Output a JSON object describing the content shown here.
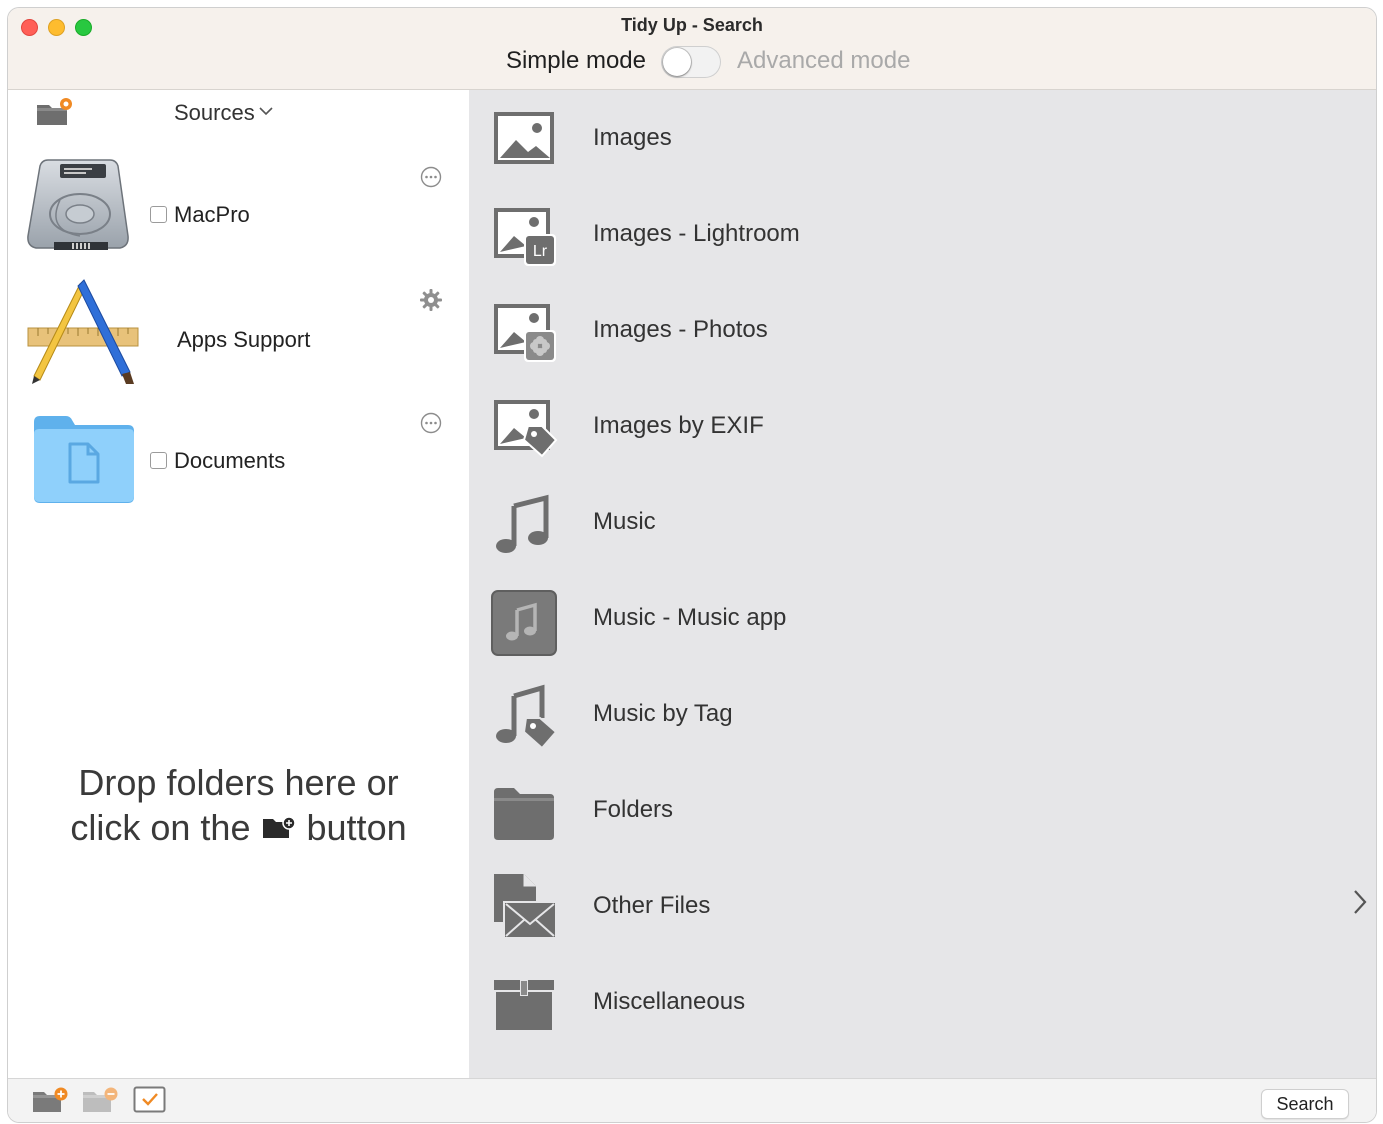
{
  "window": {
    "title": "Tidy Up - Search",
    "mode_simple": "Simple mode",
    "mode_advanced": "Advanced mode",
    "mode_toggle_on": false
  },
  "sidebar": {
    "header": "Sources",
    "items": [
      {
        "label": "MacPro",
        "icon": "hard-drive-icon",
        "action_icon": "ellipsis-circle-icon",
        "checked": false
      },
      {
        "label": "Apps Support",
        "icon": "app-store-tools-icon",
        "action_icon": "gear-icon"
      },
      {
        "label": "Documents",
        "icon": "documents-folder-icon",
        "action_icon": "ellipsis-circle-icon",
        "checked": false
      }
    ],
    "drop_hint_line1": "Drop folders here or",
    "drop_hint_line2a": "click on the",
    "drop_hint_line2b": "button"
  },
  "categories": [
    {
      "label": "Images",
      "icon": "image-icon"
    },
    {
      "label": "Images - Lightroom",
      "icon": "image-lightroom-icon",
      "badge": "Lr"
    },
    {
      "label": "Images - Photos",
      "icon": "image-photos-icon"
    },
    {
      "label": "Images by EXIF",
      "icon": "image-tag-icon"
    },
    {
      "label": "Music",
      "icon": "music-note-icon"
    },
    {
      "label": "Music - Music app",
      "icon": "music-app-icon"
    },
    {
      "label": "Music by Tag",
      "icon": "music-tag-icon"
    },
    {
      "label": "Folders",
      "icon": "folder-icon"
    },
    {
      "label": "Other Files",
      "icon": "other-files-icon"
    },
    {
      "label": "Miscellaneous",
      "icon": "box-icon"
    }
  ],
  "bottombar": {
    "search_label": "Search"
  },
  "colors": {
    "accent_orange": "#f08a24",
    "icon_gray": "#6e6e6e",
    "main_bg": "#e6e6e8"
  }
}
